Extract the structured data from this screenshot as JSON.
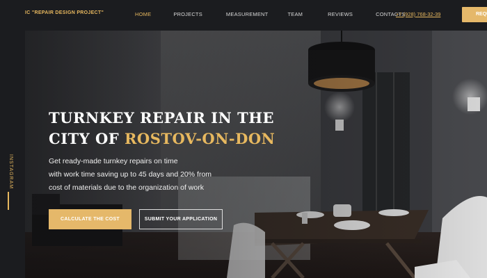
{
  "header": {
    "logo": "IC \"REPAIR DESIGN PROJECT\"",
    "nav": [
      {
        "label": "HOME",
        "active": true
      },
      {
        "label": "PROJECTS"
      },
      {
        "label": "MEASUREMENT"
      },
      {
        "label": "TEAM"
      },
      {
        "label": "REVIEWS"
      },
      {
        "label": "CONTACTS"
      }
    ],
    "phone": "+7 (928) 768-32-39",
    "request_button": "REQU"
  },
  "side": {
    "instagram": "INSTAGRAM"
  },
  "hero": {
    "title_line1": "TURNKEY REPAIR IN THE",
    "title_line2_prefix": "CITY OF ",
    "title_accent": "ROSTOV-ON-DON",
    "subtitle_line1": "Get ready-made turnkey repairs on time",
    "subtitle_line2": "with work time saving up to 45 days and 20% from",
    "subtitle_line3": "cost of materials due to the organization of work",
    "primary_button": "CALCULATE THE COST",
    "secondary_button": "SUBMIT YOUR APPLICATION"
  },
  "colors": {
    "accent": "#e7b85f",
    "background": "#1b1c1f"
  }
}
